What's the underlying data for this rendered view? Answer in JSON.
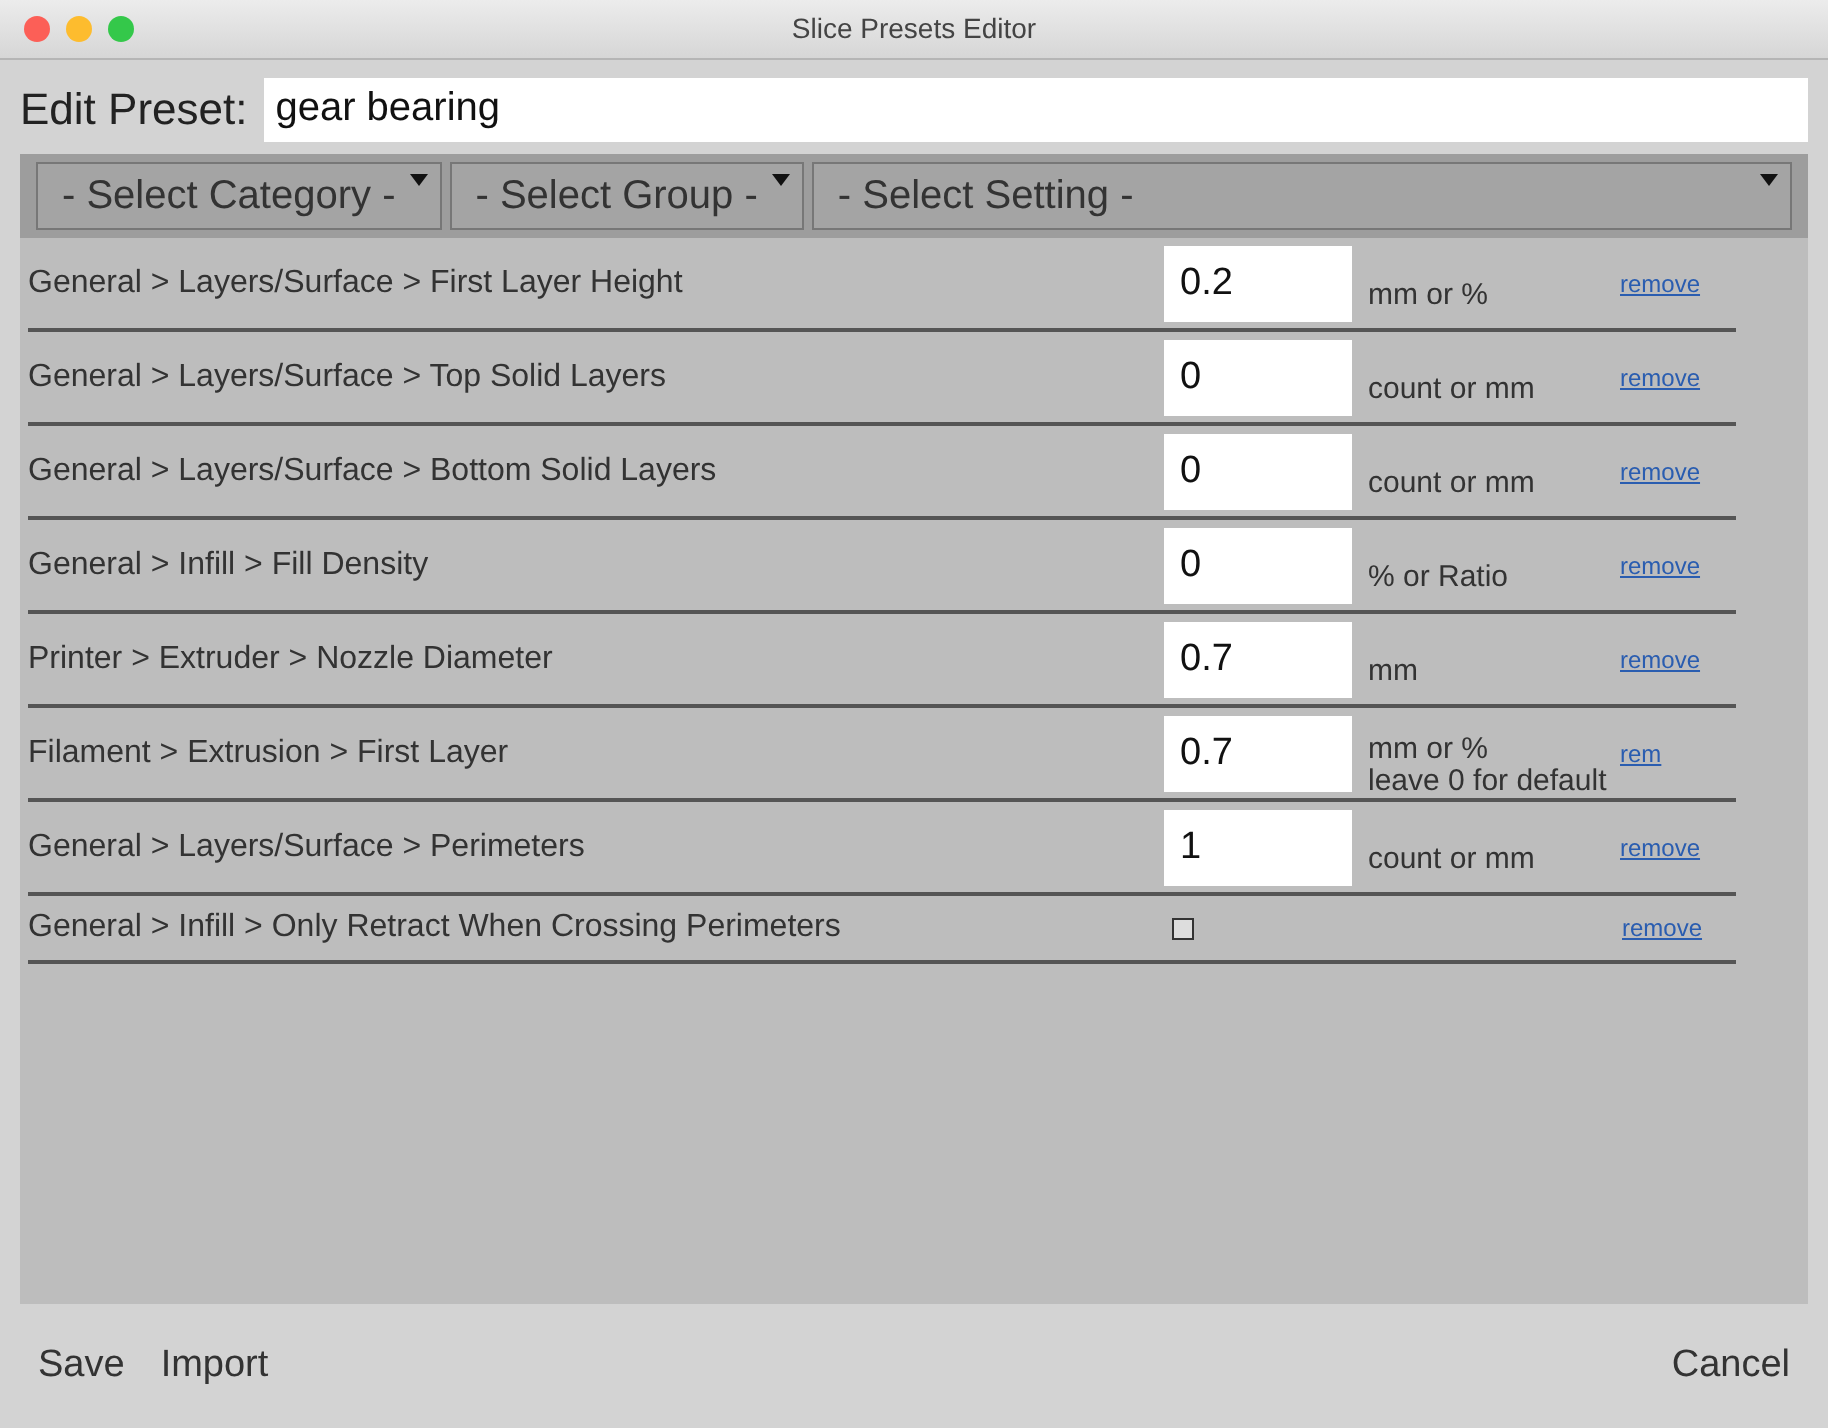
{
  "window": {
    "title": "Slice Presets Editor"
  },
  "preset": {
    "label": "Edit Preset:",
    "value": "gear bearing"
  },
  "selects": [
    {
      "label": "- Select Category -"
    },
    {
      "label": "- Select Group -"
    },
    {
      "label": "- Select Setting -"
    }
  ],
  "settings": [
    {
      "kind": "text",
      "path": "General > Layers/Surface > First Layer Height",
      "value": "0.2",
      "unit": "mm or %",
      "remove": "remove"
    },
    {
      "kind": "text",
      "path": "General > Layers/Surface > Top Solid Layers",
      "value": "0",
      "unit": "count or mm",
      "remove": "remove"
    },
    {
      "kind": "text",
      "path": "General > Layers/Surface > Bottom Solid Layers",
      "value": "0",
      "unit": "count or mm",
      "remove": "remove"
    },
    {
      "kind": "text",
      "path": "General > Infill > Fill Density",
      "value": "0",
      "unit": "% or Ratio",
      "remove": "remove"
    },
    {
      "kind": "text",
      "path": "Printer > Extruder > Nozzle Diameter",
      "value": "0.7",
      "unit": "mm",
      "remove": "remove"
    },
    {
      "kind": "text",
      "path": "Filament > Extrusion > First Layer",
      "value": "0.7",
      "unit": "mm or %\nleave 0 for default",
      "remove": "rem"
    },
    {
      "kind": "text",
      "path": "General > Layers/Surface > Perimeters",
      "value": "1",
      "unit": "count or mm",
      "remove": "remove"
    },
    {
      "kind": "checkbox",
      "path": "General > Infill > Only Retract When Crossing Perimeters",
      "checked": false,
      "remove": "remove"
    }
  ],
  "footer": {
    "left_buttons": [
      "Save",
      "Import"
    ],
    "right_buttons": [
      "Cancel"
    ]
  }
}
